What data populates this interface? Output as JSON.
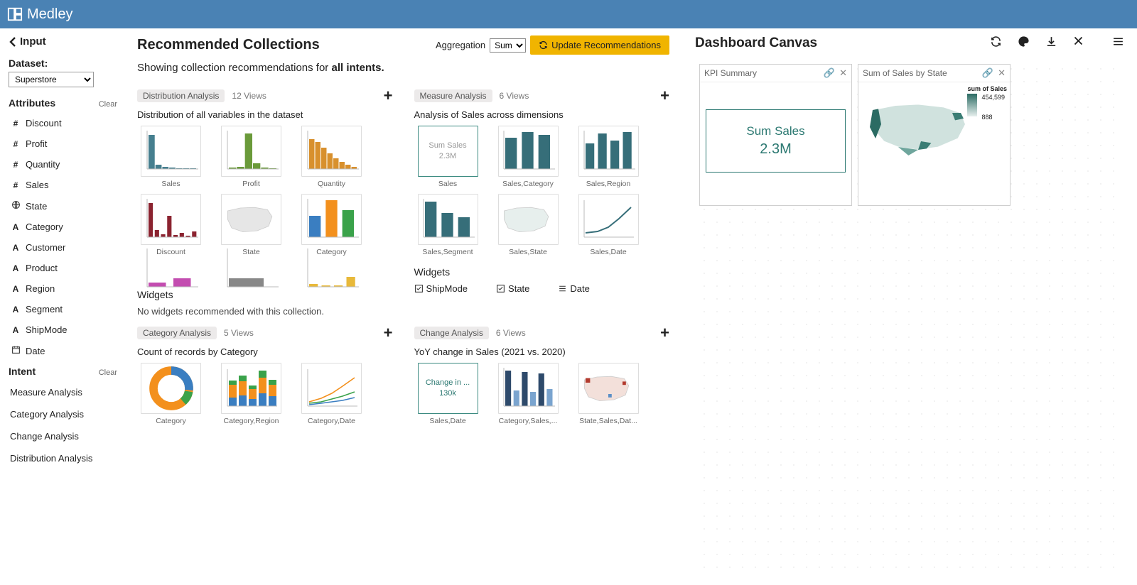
{
  "app_title": "Medley",
  "sidebar": {
    "back_label": "Input",
    "dataset_label": "Dataset:",
    "dataset_value": "Superstore",
    "attributes_label": "Attributes",
    "clear_label": "Clear",
    "attributes": [
      {
        "icon": "#",
        "label": "Discount"
      },
      {
        "icon": "#",
        "label": "Profit"
      },
      {
        "icon": "#",
        "label": "Quantity"
      },
      {
        "icon": "#",
        "label": "Sales"
      },
      {
        "icon": "globe",
        "label": "State"
      },
      {
        "icon": "A",
        "label": "Category"
      },
      {
        "icon": "A",
        "label": "Customer"
      },
      {
        "icon": "A",
        "label": "Product"
      },
      {
        "icon": "A",
        "label": "Region"
      },
      {
        "icon": "A",
        "label": "Segment"
      },
      {
        "icon": "A",
        "label": "ShipMode"
      },
      {
        "icon": "cal",
        "label": "Date"
      }
    ],
    "intent_label": "Intent",
    "intents": [
      "Measure Analysis",
      "Category Analysis",
      "Change Analysis",
      "Distribution Analysis"
    ]
  },
  "center": {
    "title": "Recommended Collections",
    "agg_label": "Aggregation",
    "agg_value": "Sum",
    "update_label": "Update Recommendations",
    "subline_prefix": "Showing collection recommendations for ",
    "subline_bold": "all intents",
    "collections": [
      {
        "tag": "Distribution Analysis",
        "views": "12 Views",
        "desc": "Distribution of all variables in the dataset",
        "thumbs": [
          "Sales",
          "Profit",
          "Quantity",
          "Discount",
          "State",
          "Category"
        ],
        "widgets_title": "Widgets",
        "widgets_none": "No widgets recommended with this collection."
      },
      {
        "tag": "Measure Analysis",
        "views": "6 Views",
        "desc": "Analysis of Sales across dimensions",
        "thumbs": [
          "Sales",
          "Sales,Category",
          "Sales,Region",
          "Sales,Segment",
          "Sales,State",
          "Sales,Date"
        ],
        "widgets_title": "Widgets",
        "widgets": [
          {
            "icon": "check",
            "label": "ShipMode"
          },
          {
            "icon": "check",
            "label": "State"
          },
          {
            "icon": "list",
            "label": "Date"
          }
        ]
      },
      {
        "tag": "Category Analysis",
        "views": "5 Views",
        "desc": "Count of records by Category",
        "thumbs": [
          "Category",
          "Category,Region",
          "Category,Date"
        ]
      },
      {
        "tag": "Change Analysis",
        "views": "6 Views",
        "desc": "YoY change in Sales (2021 vs. 2020)",
        "thumbs": [
          "Sales,Date",
          "Category,Sales,...",
          "State,Sales,Dat..."
        ]
      }
    ]
  },
  "right": {
    "title": "Dashboard Canvas",
    "cards": [
      {
        "title": "KPI Summary",
        "kpi_title": "Sum Sales",
        "kpi_value": "2.3M"
      },
      {
        "title": "Sum of Sales by State",
        "legend_title": "sum of Sales",
        "legend_max": "454,599",
        "legend_min": "888"
      }
    ]
  },
  "kpi_mini": {
    "t": "Sum Sales",
    "v": "2.3M"
  },
  "change_mini": {
    "t": "Change in ...",
    "v": "130k"
  }
}
